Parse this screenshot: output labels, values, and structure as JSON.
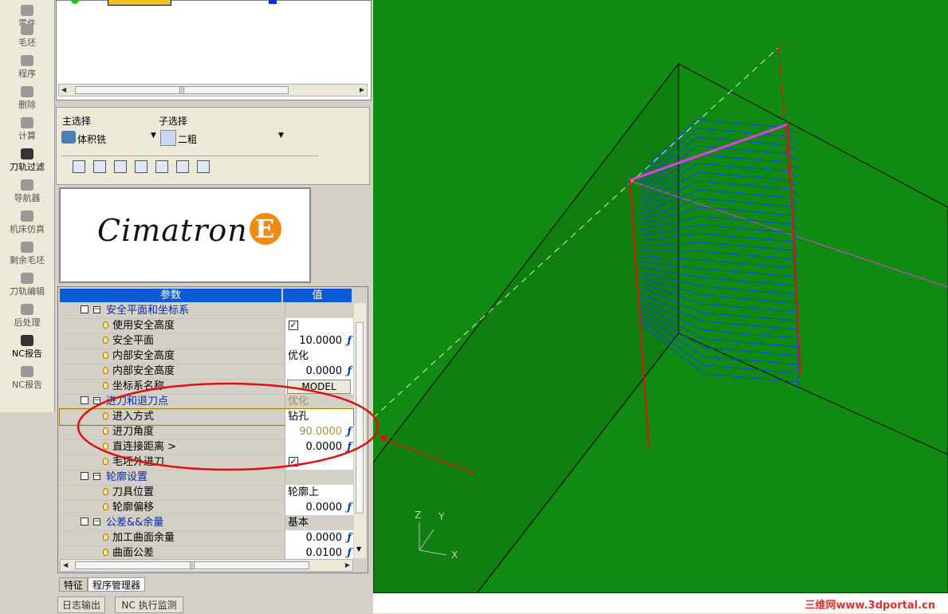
{
  "left_toolbar": {
    "items": [
      {
        "label": "零件",
        "icon": "part-icon"
      },
      {
        "label": "毛坯",
        "icon": "stock-icon"
      },
      {
        "label": "程序",
        "icon": "program-icon"
      },
      {
        "label": "删除",
        "icon": "delete-icon"
      },
      {
        "label": "计算",
        "icon": "compute-icon"
      },
      {
        "label": "刀轨过滤",
        "icon": "toolpath-filter-icon"
      },
      {
        "label": "导航器",
        "icon": "navigator-icon"
      },
      {
        "label": "机床仿真",
        "icon": "machine-sim-icon"
      },
      {
        "label": "剩余毛坯",
        "icon": "remaining-stock-icon"
      },
      {
        "label": "刀轨编辑",
        "icon": "toolpath-edit-icon"
      },
      {
        "label": "后处理",
        "icon": "post-process-icon"
      },
      {
        "label": "NC报告",
        "icon": "nc-report-icon"
      },
      {
        "label": "NC报告",
        "icon": "nc-report-icon"
      }
    ]
  },
  "selection": {
    "main_label": "主选择",
    "main_value": "体积铣",
    "sub_label": "子选择",
    "sub_value": "二粗",
    "tools": [
      "new-procedure-icon",
      "open-icon",
      "copy-icon",
      "edit-icon",
      "tool-icon",
      "cut-icon",
      "export-icon"
    ]
  },
  "logo": {
    "text": "Cimatron",
    "letter": "E"
  },
  "params": {
    "header_name": "参数",
    "header_value": "值",
    "rows": [
      {
        "type": "group",
        "name": "安全平面和坐标系",
        "value": ""
      },
      {
        "type": "item",
        "name": "使用安全高度",
        "value": "✓",
        "check": true
      },
      {
        "type": "item",
        "name": "安全平面",
        "value": "10.0000",
        "fx": true
      },
      {
        "type": "item",
        "name": "内部安全高度",
        "value": "优化"
      },
      {
        "type": "item",
        "name": "内部安全高度",
        "value": "0.0000",
        "fx": true
      },
      {
        "type": "item",
        "name": "坐标系名称",
        "value": "MODEL",
        "button": true
      },
      {
        "type": "group",
        "name": "进刀和退刀点",
        "value": "优化",
        "muted": true
      },
      {
        "type": "item",
        "name": "进入方式",
        "value": "钻孔",
        "selected": true
      },
      {
        "type": "item",
        "name": "进刀角度",
        "value": "90.0000",
        "fx": true,
        "muted": true
      },
      {
        "type": "item",
        "name": "直连接距离 >",
        "value": "0.0000",
        "fx": true
      },
      {
        "type": "item",
        "name": "毛坯外进刀",
        "value": "✓",
        "check": true
      },
      {
        "type": "group",
        "name": "轮廓设置",
        "value": ""
      },
      {
        "type": "item",
        "name": "刀具位置",
        "value": "轮廓上"
      },
      {
        "type": "item",
        "name": "轮廓偏移",
        "value": "0.0000",
        "fx": true
      },
      {
        "type": "group",
        "name": "公差&&余量",
        "value": "基本"
      },
      {
        "type": "item",
        "name": "加工曲面余量",
        "value": "0.0000",
        "fx": true
      },
      {
        "type": "item",
        "name": "曲面公差",
        "value": "0.0100",
        "fx": true
      }
    ]
  },
  "tabs": {
    "feature": "特征",
    "program_manager": "程序管理器"
  },
  "bottom_tabs": {
    "log": "日志输出",
    "nc_monitor": "NC 执行监测"
  },
  "axes": {
    "z": "Z",
    "y": "Y",
    "x": "X"
  },
  "watermark": "三维网www.3dportal.cn",
  "colors": {
    "viewport_bg": "#108a10",
    "header_blue": "#0b5bd6",
    "annotation_red": "#e01010",
    "toolpath_blue": "#1a3cff",
    "toolpath_magenta": "#e040e0"
  }
}
